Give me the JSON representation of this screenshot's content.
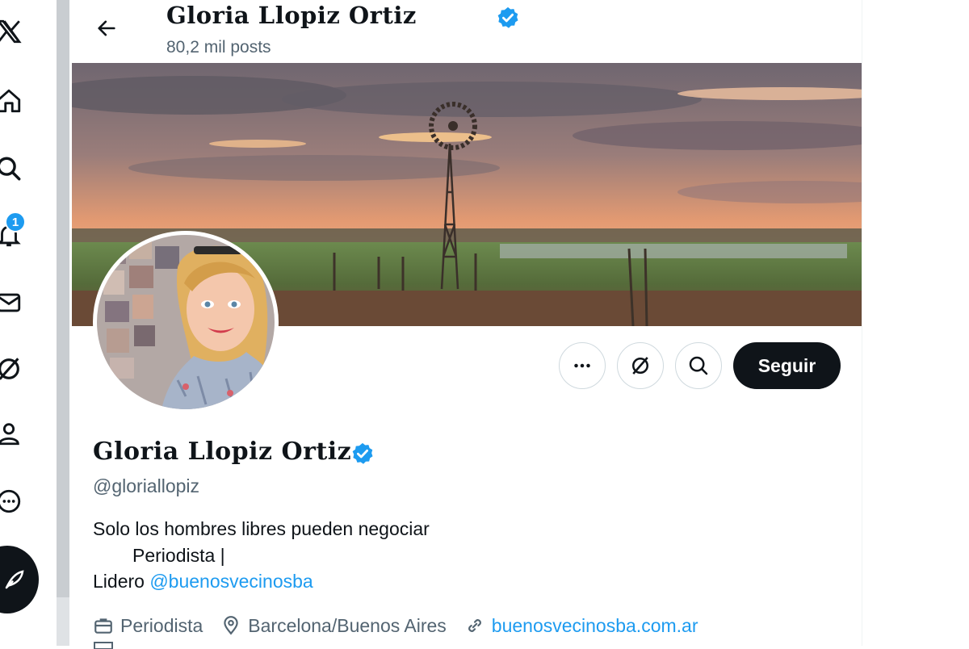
{
  "nav": {
    "items": [
      "x-logo",
      "home",
      "explore",
      "notifications",
      "messages",
      "grok",
      "profile",
      "more"
    ],
    "notifications_badge": "1"
  },
  "header": {
    "name": "Gloria Llopiz Ortiz",
    "posts_count": "80,2 mil posts"
  },
  "profile": {
    "name": "Gloria Llopiz Ortiz",
    "handle": "@gloriallopiz",
    "bio_line1": "Solo los hombres libres pueden negociar",
    "bio_line2": "Periodista |",
    "bio_line3_prefix": "Lidero ",
    "bio_mention": "@buenosvecinosba",
    "profession": "Periodista",
    "location": "Barcelona/Buenos Aires",
    "website": "buenosvecinosba.com.ar"
  },
  "actions": {
    "follow_label": "Seguir"
  },
  "colors": {
    "accent": "#1d9bf0",
    "text_primary": "#0f1419",
    "text_secondary": "#536471",
    "follow_bg": "#0f1419"
  }
}
